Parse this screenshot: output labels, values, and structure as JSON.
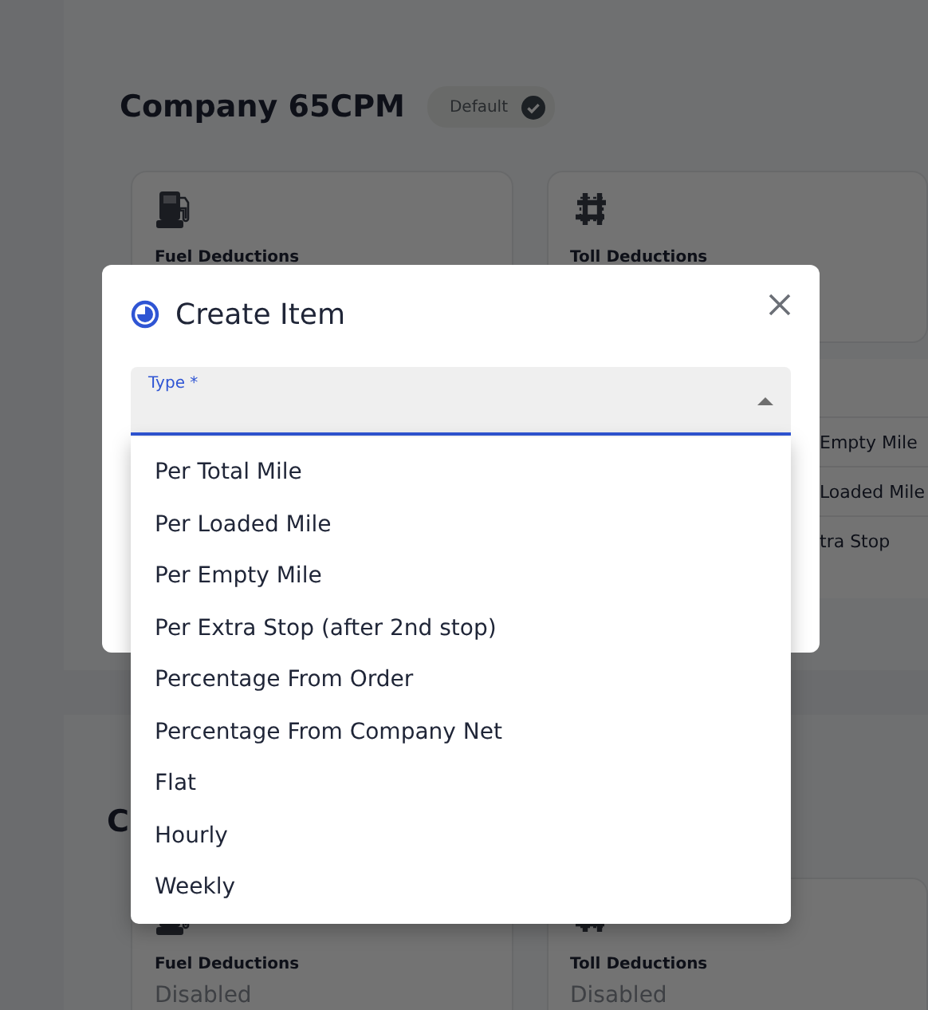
{
  "sections": [
    {
      "title": "Company 65CPM",
      "badge": {
        "label": "Default"
      },
      "cards": [
        {
          "kind": "fuel",
          "title": "Fuel Deductions"
        },
        {
          "kind": "toll",
          "title": "Toll Deductions"
        }
      ],
      "rates": [
        "Empty Mile",
        "Loaded Mile",
        "tra Stop"
      ]
    },
    {
      "title": "C",
      "cards": [
        {
          "kind": "fuel",
          "title": "Fuel Deductions",
          "status": "Disabled"
        },
        {
          "kind": "toll",
          "title": "Toll Deductions",
          "status": "Disabled"
        }
      ]
    }
  ],
  "modal": {
    "title": "Create Item",
    "field": {
      "label": "Type *",
      "open": true
    },
    "options": [
      {
        "label": "Per Total Mile",
        "selected": false
      },
      {
        "label": "Per Loaded Mile",
        "selected": false
      },
      {
        "label": "Per Empty Mile",
        "selected": false
      },
      {
        "label": "Per Extra Stop (after 2nd stop)",
        "selected": false
      },
      {
        "label": "Percentage From Order",
        "selected": false
      },
      {
        "label": "Percentage From Company Net",
        "selected": false
      },
      {
        "label": "Flat",
        "selected": false
      },
      {
        "label": "Hourly",
        "selected": false
      },
      {
        "label": "Weekly",
        "selected": false
      }
    ]
  }
}
